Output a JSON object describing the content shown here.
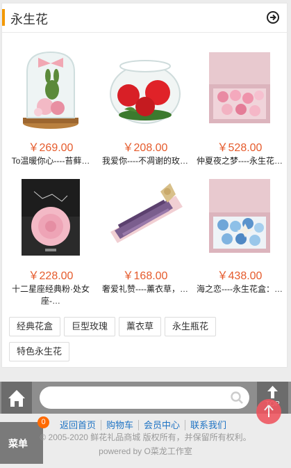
{
  "section": {
    "title": "永生花",
    "more_icon": "arrow-right-circle-icon"
  },
  "products": [
    {
      "price": "￥269.00",
      "name": "To温暖你心----苔藓…",
      "image": "glass-dome-bunny-flowers"
    },
    {
      "price": "￥208.00",
      "name": "我爱你----不凋谢的玫…",
      "image": "glass-bowl-red-roses"
    },
    {
      "price": "￥528.00",
      "name": "仲夏夜之梦----永生花…",
      "image": "pink-box-pink-roses"
    },
    {
      "price": "￥228.00",
      "name": "十二星座经典粉·处女座-…",
      "image": "black-box-pink-rose"
    },
    {
      "price": "￥168.00",
      "name": "奢爱礼赞----薰衣草，…",
      "image": "lavender-bouquet-box"
    },
    {
      "price": "￥438.00",
      "name": "海之恋----永生花盒：…",
      "image": "pink-box-blue-roses"
    }
  ],
  "tags": [
    "经典花盒",
    "巨型玫瑰",
    "薰衣草",
    "永生瓶花",
    "特色永生花"
  ],
  "search": {
    "placeholder": "",
    "icon": "search-icon"
  },
  "nav": {
    "home_icon": "home-icon",
    "top_label": "TOP",
    "top_icon": "arrow-up-icon",
    "menu_label": "菜单",
    "cart_count": "0"
  },
  "footer": {
    "links": [
      "返回首页",
      "购物车",
      "会员中心",
      "联系我们"
    ],
    "copyright": "© 2005-2020 鲜花礼品商城 版权所有，并保留所有权利。",
    "powered": "powered by O菜龙工作室"
  },
  "colors": {
    "accent": "#f39800",
    "price": "#e55a2b",
    "link": "#1e73c4",
    "float_button": "#ef5862"
  }
}
